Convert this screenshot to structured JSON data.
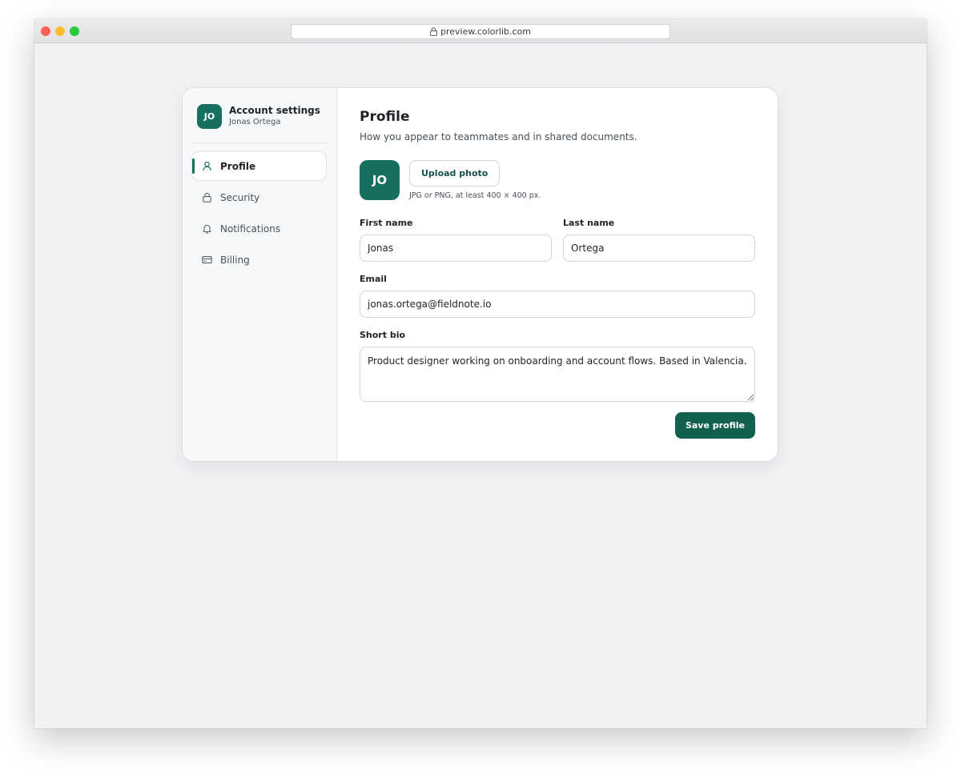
{
  "browser": {
    "url": "preview.colorlib.com"
  },
  "sidebar": {
    "avatar_initials": "JO",
    "title": "Account settings",
    "user_name": "Jonas Ortega",
    "items": [
      {
        "label": "Profile",
        "icon": "user-icon",
        "active": true
      },
      {
        "label": "Security",
        "icon": "lock-icon",
        "active": false
      },
      {
        "label": "Notifications",
        "icon": "bell-icon",
        "active": false
      },
      {
        "label": "Billing",
        "icon": "credit-card-icon",
        "active": false
      }
    ]
  },
  "main": {
    "title": "Profile",
    "subtitle": "How you appear to teammates and in shared documents.",
    "photo": {
      "avatar_initials": "JO",
      "upload_label": "Upload photo",
      "hint": "JPG or PNG, at least 400 × 400 px."
    },
    "fields": {
      "first_name": {
        "label": "First name",
        "value": "Jonas"
      },
      "last_name": {
        "label": "Last name",
        "value": "Ortega"
      },
      "email": {
        "label": "Email",
        "value": "jonas.ortega@fieldnote.io"
      },
      "bio": {
        "label": "Short bio",
        "value": "Product designer working on onboarding and account flows. Based in Valencia."
      }
    },
    "save_label": "Save profile"
  },
  "colors": {
    "accent": "#166f5f",
    "button": "#12604f"
  }
}
